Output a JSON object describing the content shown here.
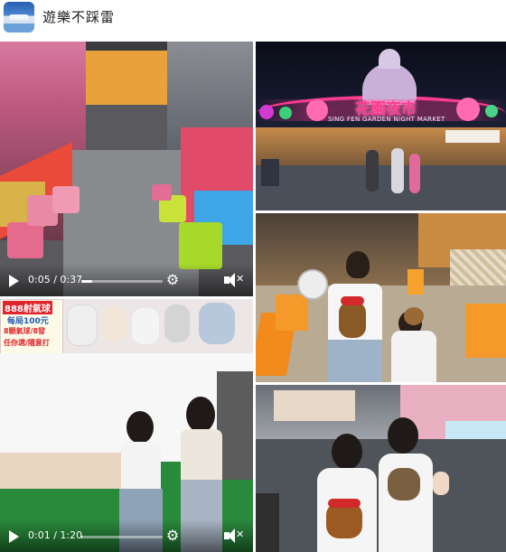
{
  "post": {
    "author_name": "遊樂不踩雷"
  },
  "video1": {
    "time": "0:05 / 0:37",
    "progress": 0.135
  },
  "photo_market": {
    "sign_main": "花園夜市",
    "sign_sub": "SING FEN GARDEN NIGHT MARKET"
  },
  "video2": {
    "time": "0:01 / 1:20",
    "progress": 0.01,
    "booth_sign_title": "888射氣球",
    "booth_sign_line1": "每局100元",
    "booth_sign_line2": "8顆氣球/8發",
    "booth_sign_line3": "任你選/隨意打"
  },
  "colors": {
    "header_text": "#1c1e21",
    "neon_pink": "#ff3b8f",
    "sign_red": "#e0262d"
  }
}
